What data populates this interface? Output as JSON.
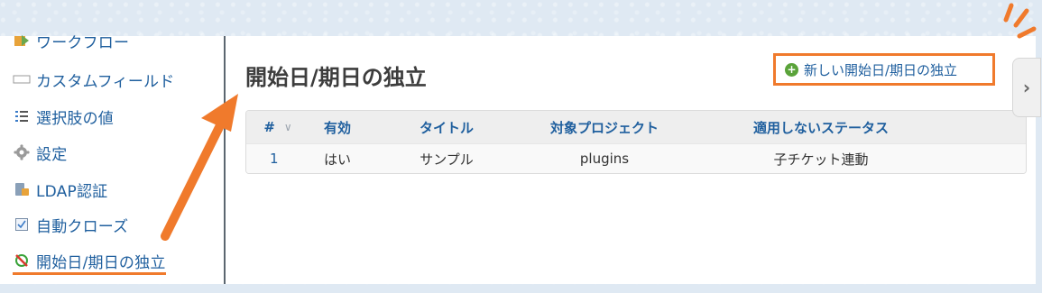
{
  "sidebar": {
    "items": [
      {
        "label": "ワークフロー",
        "icon": "workflow-icon"
      },
      {
        "label": "カスタムフィールド",
        "icon": "custom-field-icon"
      },
      {
        "label": "選択肢の値",
        "icon": "list-icon"
      },
      {
        "label": "設定",
        "icon": "gear-icon"
      },
      {
        "label": "LDAP認証",
        "icon": "ldap-icon"
      },
      {
        "label": "自動クローズ",
        "icon": "checkbox-icon"
      },
      {
        "label": "開始日/期日の独立",
        "icon": "independent-dates-icon"
      }
    ],
    "active_index": 6
  },
  "main": {
    "title": "開始日/期日の独立",
    "new_link_label": "新しい開始日/期日の独立",
    "table": {
      "headers": [
        "#",
        "有効",
        "タイトル",
        "対象プロジェクト",
        "適用しないステータス"
      ],
      "rows": [
        [
          "1",
          "はい",
          "サンプル",
          "plugins",
          "子チケット連動"
        ]
      ]
    }
  },
  "annotation_color": "#f07a2c",
  "link_color": "#1f5f9e"
}
